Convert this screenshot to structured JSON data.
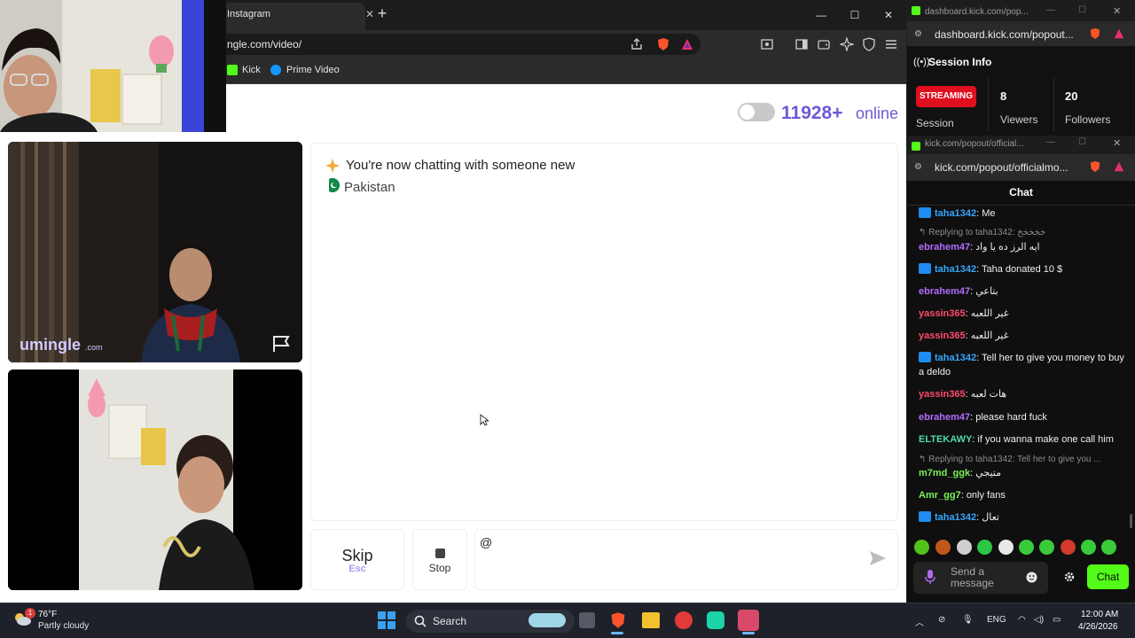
{
  "browser": {
    "tab_title": "Instagram",
    "url": "ngle.com/video/",
    "bookmarks": [
      {
        "label": "Kick"
      },
      {
        "label": "Prime Video"
      }
    ]
  },
  "site": {
    "online_count": "11928+",
    "online_label": "online",
    "brand": "umingle",
    "brand_domain": ".com",
    "chat_status": "You're now chatting with someone new",
    "country": "Pakistan",
    "skip_label": "Skip",
    "skip_hint": "Esc",
    "stop_label": "Stop",
    "message_value": "@"
  },
  "session_window": {
    "title": "dashboard.kick.com/pop...",
    "url": "dashboard.kick.com/popout...",
    "heading": "Session Info",
    "status": "STREAMING",
    "status_caption": "Session",
    "viewers": "8",
    "viewers_label": "Viewers",
    "followers": "20",
    "followers_label": "Followers"
  },
  "chat_window": {
    "title": "kick.com/popout/official...",
    "url": "kick.com/popout/officialmo...",
    "heading": "Chat",
    "messages": [
      {
        "user": "taha1342",
        "text": "Me"
      },
      {
        "reply": "Replying to taha1342: خخخخخ",
        "user": "ebrahem47",
        "text": "ايه الرز ده يا واد"
      },
      {
        "user": "taha1342",
        "text": "Taha donated 10 $"
      },
      {
        "user": "ebrahem47",
        "text": "بتاعي"
      },
      {
        "user": "yassin365",
        "text": "غير اللعبه"
      },
      {
        "user": "yassin365",
        "text": "غير اللعبه"
      },
      {
        "user": "taha1342",
        "text": "Tell her to give you money to buy a deldo"
      },
      {
        "user": "yassin365",
        "text": "هات لعبه"
      },
      {
        "user": "ebrahem47",
        "text": "please hard fuck"
      },
      {
        "user": "ELTEKAWY",
        "text": "if you wanna make one call him"
      },
      {
        "reply": "Replying to taha1342: Tell her to give you ...",
        "user": "m7md_ggk",
        "text": "متيجي"
      },
      {
        "user": "Amr_gg7",
        "text": "only fans"
      },
      {
        "user": "taha1342",
        "text": "تعال"
      }
    ],
    "send_placeholder": "Send a message",
    "chat_button": "Chat"
  },
  "taskbar": {
    "weather_temp": "76°F",
    "weather_desc": "Partly cloudy",
    "notification_count": "1",
    "search_label": "Search",
    "language": "ENG",
    "time": "12:00 AM",
    "date": "4/26/2026"
  },
  "colors": {
    "kick_green": "#53fc18",
    "online_purple": "#6a5ad6",
    "streaming_red": "#e00f1f",
    "user_blue": "#33a8ff",
    "user_purple": "#b36cff",
    "user_red": "#ff4a6b",
    "user_teal": "#4fd6b0",
    "user_green": "#7cf05a"
  }
}
